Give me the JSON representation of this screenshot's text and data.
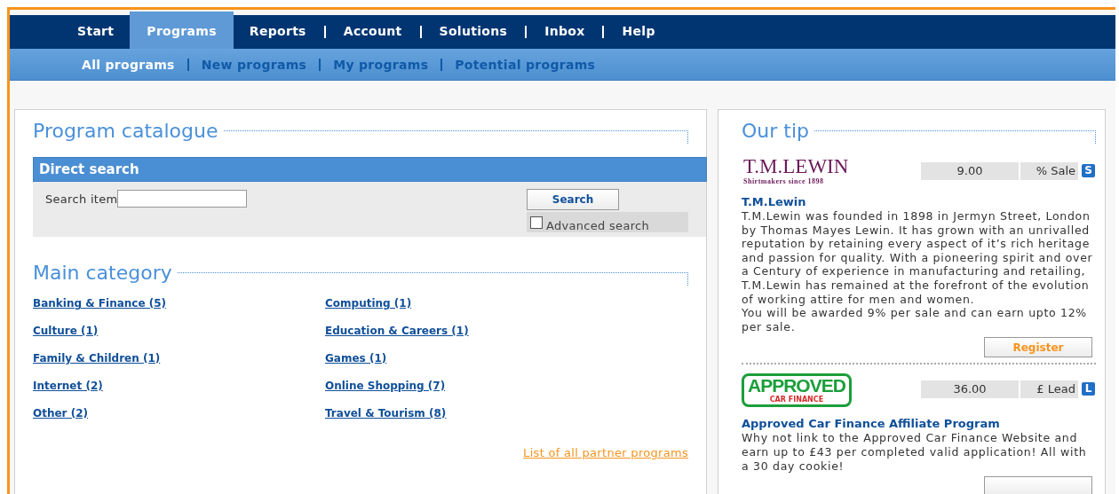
{
  "nav": {
    "tabs": [
      {
        "label": "Start",
        "selected": false
      },
      {
        "label": "Programs",
        "selected": true
      },
      {
        "label": "Reports",
        "selected": false
      },
      {
        "label": "Account",
        "selected": false
      },
      {
        "label": "Solutions",
        "selected": false
      },
      {
        "label": "Inbox",
        "selected": false
      },
      {
        "label": "Help",
        "selected": false
      }
    ],
    "subtabs": [
      {
        "label": "All programs",
        "selected": true
      },
      {
        "label": "New programs",
        "selected": false
      },
      {
        "label": "My programs",
        "selected": false
      },
      {
        "label": "Potential programs",
        "selected": false
      }
    ]
  },
  "catalogue": {
    "title": "Program catalogue",
    "direct_search": {
      "title": "Direct search",
      "label": "Search item",
      "button": "Search",
      "advanced": {
        "label": "Advanced search",
        "checked": false
      }
    },
    "main_category": {
      "title": "Main category",
      "items": [
        "Banking & Finance (5)",
        "Computing (1)",
        "Culture (1)",
        "Education & Careers (1)",
        "Family & Children (1)",
        "Games (1)",
        "Internet (2)",
        "Online Shopping (7)",
        "Other (2)",
        "Travel & Tourism (8)"
      ]
    },
    "footer_link": "List of all partner programs"
  },
  "tip": {
    "title": "Our tip",
    "items": [
      {
        "kind": "wordmark",
        "logo_main": "T.M.LEWIN",
        "logo_sub": "Shirtmakers since 1898",
        "amount": "9.00",
        "unit": "% Sale",
        "badge": "S",
        "name": "T.M.Lewin",
        "description": "T.M.Lewin was founded in 1898 in Jermyn Street, London by Thomas Mayes Lewin. It has grown with an unrivalled reputation by retaining every aspect of it’s rich heritage and passion for quality. With a pioneering spirit and over a Century of experience in manufacturing and retailing, T.M.Lewin has remained at the forefront of the evolution of working attire for men and women.\nYou will be awarded 9% per sale and can earn upto 12% per sale.",
        "button": "Register"
      },
      {
        "kind": "badge",
        "logo_main": "APPROVED",
        "logo_sub": "CAR FINANCE",
        "amount": "36.00",
        "unit": "£ Lead",
        "badge": "L",
        "name": "Approved Car Finance Affiliate Program",
        "description": "Why not link to the Approved Car Finance Website and earn up to £43 per completed valid application! All with a 30 day cookie!"
      }
    ]
  }
}
